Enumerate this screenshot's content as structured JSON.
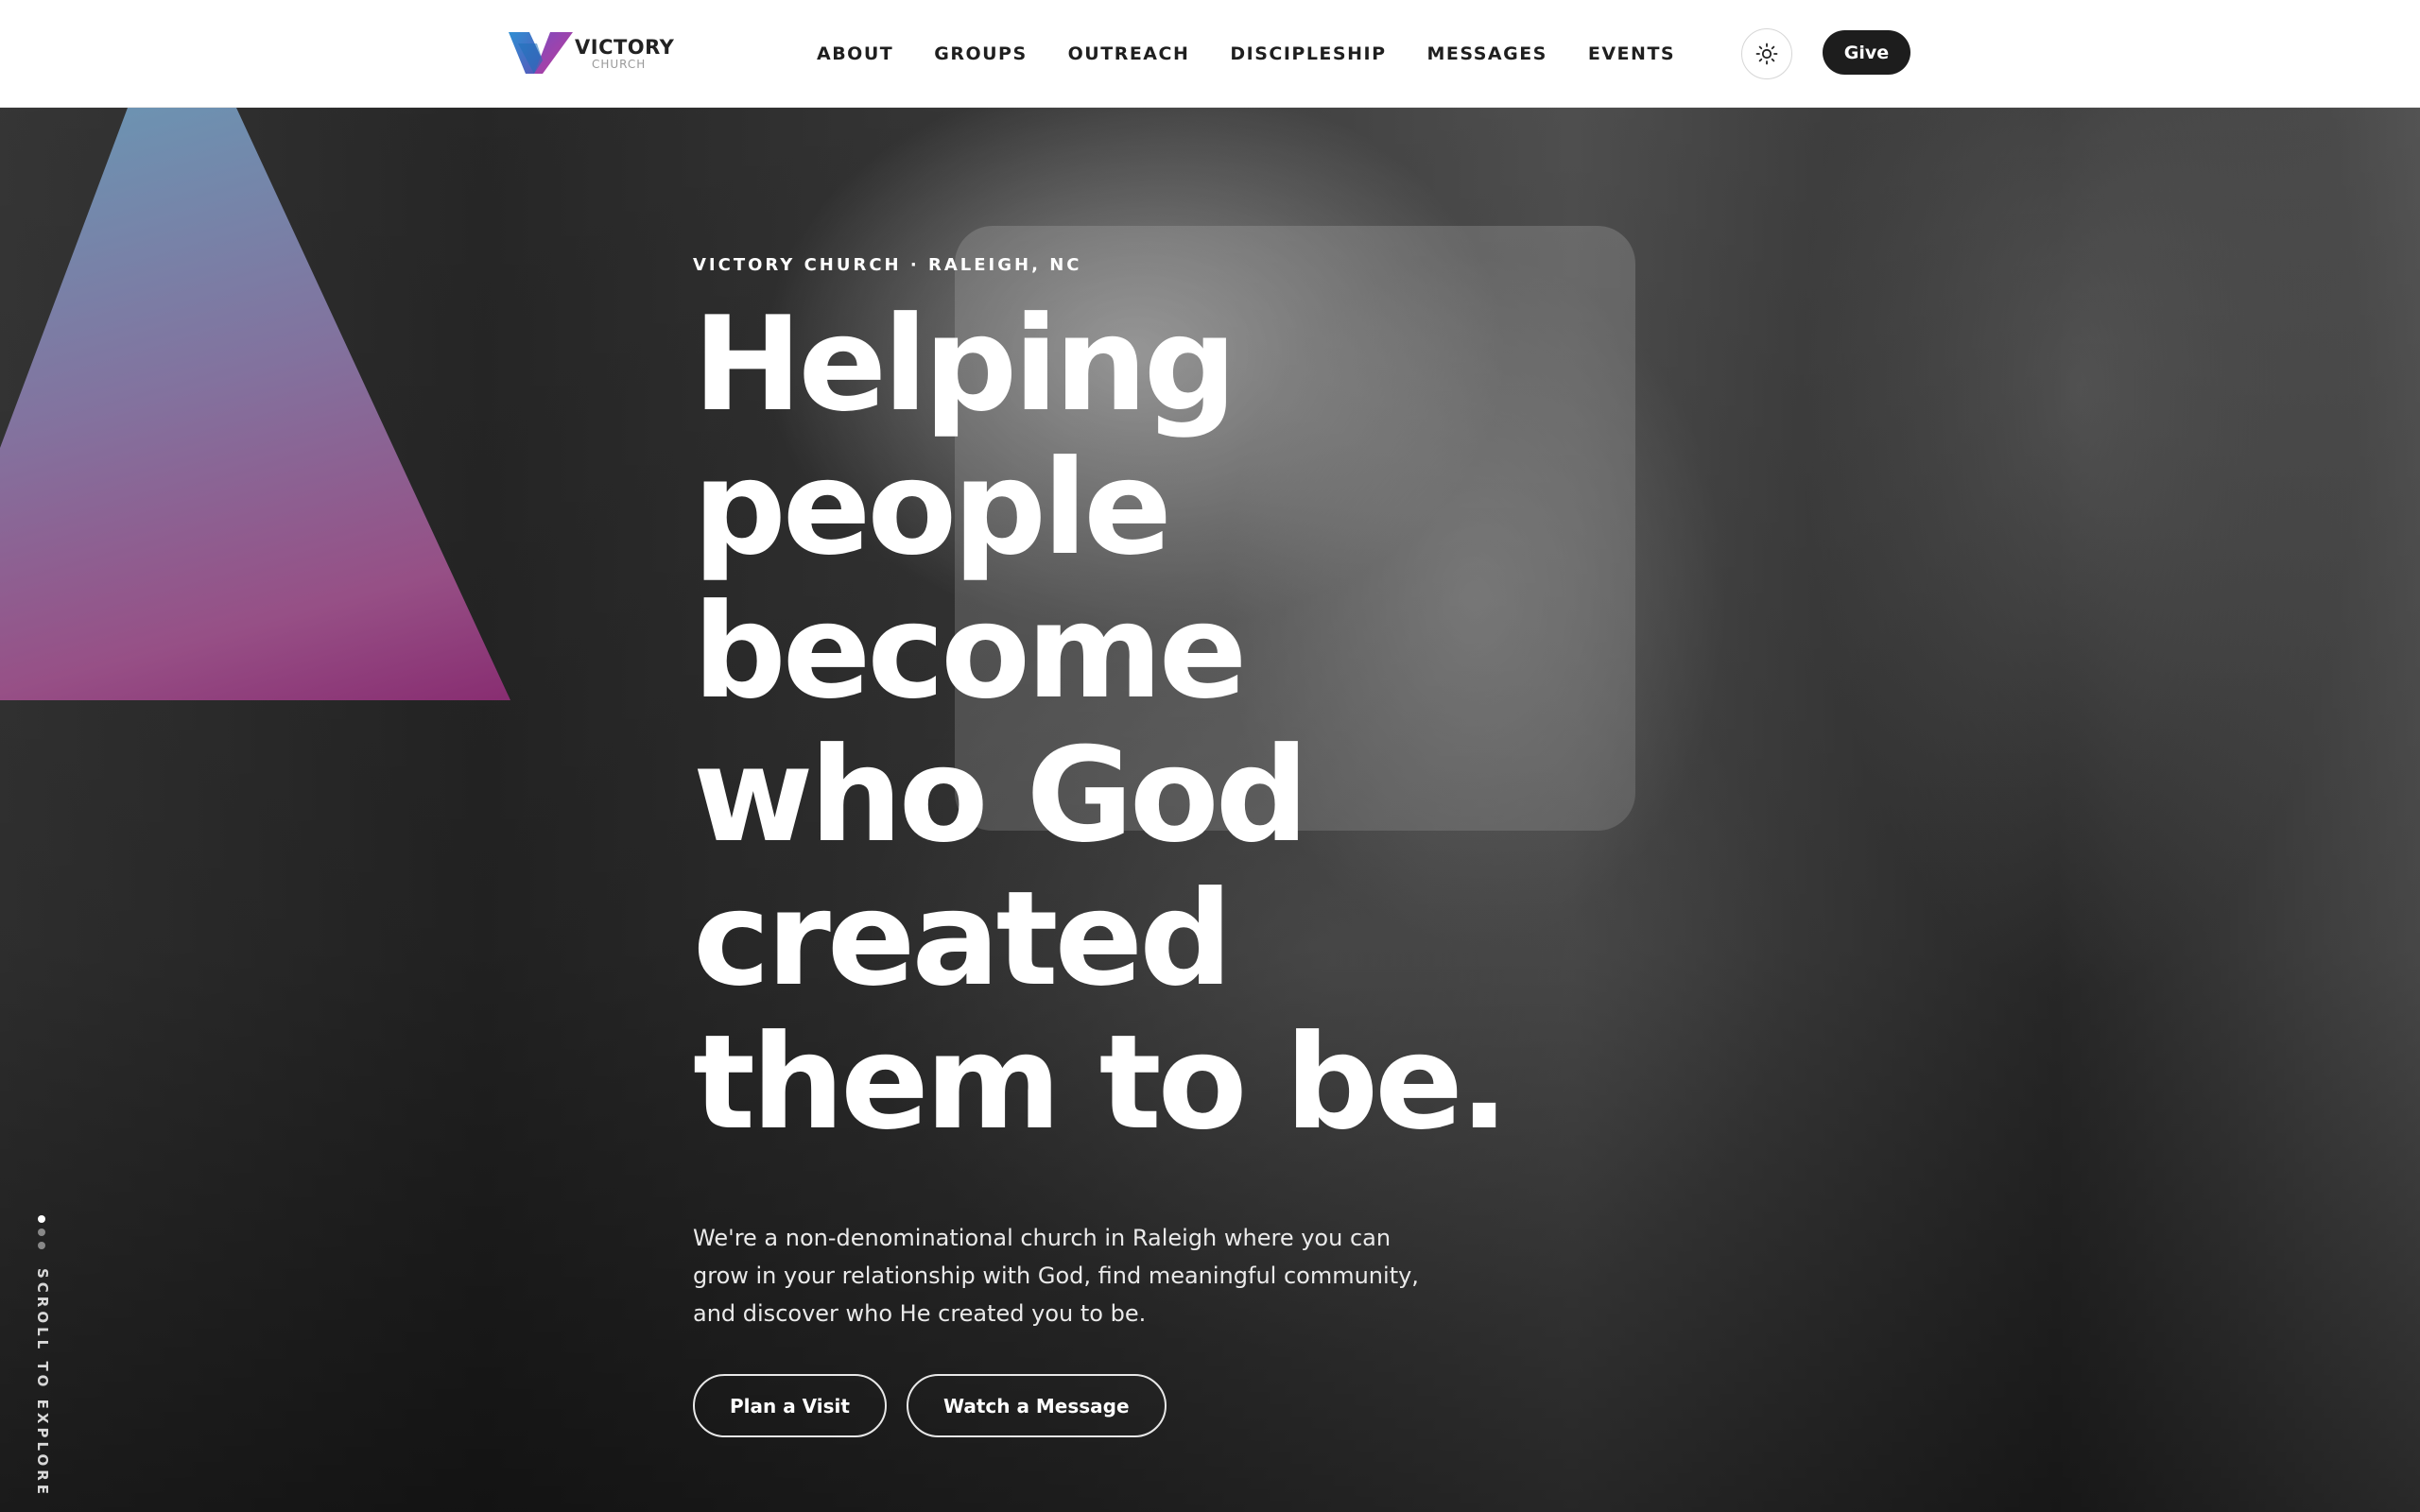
{
  "header": {
    "logo": {
      "name": "VICTORY",
      "sub": "CHURCH",
      "icon": "v-logo-icon"
    },
    "nav": [
      "ABOUT",
      "GROUPS",
      "OUTREACH",
      "DISCIPLESHIP",
      "MESSAGES",
      "EVENTS"
    ],
    "theme_toggle_icon": "sun-icon",
    "give_label": "Give"
  },
  "hero": {
    "eyebrow": "VICTORY CHURCH · RALEIGH, NC",
    "headline_lines": [
      "Helping",
      "people",
      "become",
      "who God",
      "created",
      "them to be."
    ],
    "lede": "We're a non-denominational church in Raleigh where you can grow in your relationship with God, find meaningful community, and discover who He created you to be.",
    "buttons": {
      "plan_visit": "Plan a Visit",
      "watch_message": "Watch a Message"
    },
    "scroll_label": "SCROLL TO EXPLORE",
    "slide_count": 3,
    "active_slide": 1
  },
  "colors": {
    "header_bg": "#ffffff",
    "give_button": "#1d1d1d",
    "triangle_top": "#6f9fbf",
    "triangle_bottom": "#912e78",
    "logo_blue": "#1e88c8",
    "logo_magenta": "#b03a96"
  }
}
